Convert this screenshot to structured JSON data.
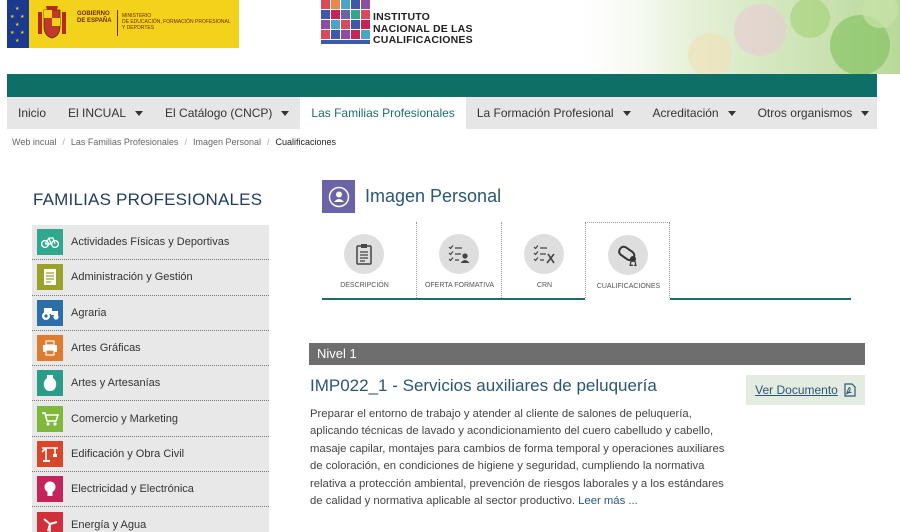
{
  "header": {
    "gov_name": [
      "GOBIERNO",
      "DE ESPAÑA"
    ],
    "ministry_name": [
      "MINISTERIO",
      "DE EDUCACIÓN, FORMACIÓN PROFESIONAL",
      "Y DEPORTES"
    ],
    "institute_name": [
      "INSTITUTO",
      "NACIONAL DE LAS",
      "CUALIFICACIONES"
    ]
  },
  "nav": {
    "items": [
      {
        "label": "Inicio",
        "dropdown": false,
        "active": false
      },
      {
        "label": "El INCUAL",
        "dropdown": true,
        "active": false
      },
      {
        "label": "El Catálogo (CNCP)",
        "dropdown": true,
        "active": false
      },
      {
        "label": "Las Familias Profesionales",
        "dropdown": false,
        "active": true
      },
      {
        "label": "La Formación Profesional",
        "dropdown": true,
        "active": false
      },
      {
        "label": "Acreditación",
        "dropdown": true,
        "active": false
      },
      {
        "label": "Otros organismos",
        "dropdown": true,
        "active": false
      }
    ]
  },
  "breadcrumb": {
    "items": [
      "Web incual",
      "Las Familias Profesionales",
      "Imagen Personal"
    ],
    "current": "Cualificaciones"
  },
  "sidebar": {
    "title": "FAMILIAS PROFESIONALES",
    "items": [
      {
        "label": "Actividades Físicas y Deportivas",
        "color": "#2fa88e",
        "icon": "bicycle-icon"
      },
      {
        "label": "Administración y Gestión",
        "color": "#9aa22c",
        "icon": "document-icon"
      },
      {
        "label": "Agraria",
        "color": "#2b6ea8",
        "icon": "tractor-icon"
      },
      {
        "label": "Artes Gráficas",
        "color": "#e07a2e",
        "icon": "printer-icon"
      },
      {
        "label": "Artes y Artesanías",
        "color": "#2a9d8a",
        "icon": "vase-icon"
      },
      {
        "label": "Comercio y Marketing",
        "color": "#7fb83a",
        "icon": "cart-icon"
      },
      {
        "label": "Edificación y Obra Civil",
        "color": "#d9472b",
        "icon": "crane-icon"
      },
      {
        "label": "Electricidad y Electrónica",
        "color": "#c4245a",
        "icon": "bulb-icon"
      },
      {
        "label": "Energía y Agua",
        "color": "#d12f3a",
        "icon": "windmill-icon"
      }
    ]
  },
  "main": {
    "family_title": "Imagen Personal",
    "family_color": "#6a63a8",
    "tabs": [
      {
        "label": "DESCRIPCIÓN",
        "icon": "clipboard-icon",
        "active": false
      },
      {
        "label": "OFERTA FORMATIVA",
        "icon": "checklist-person-icon",
        "active": false
      },
      {
        "label": "CRN",
        "icon": "checklist-tools-icon",
        "active": false
      },
      {
        "label": "CUALIFICACIONES",
        "icon": "diploma-icon",
        "active": true
      }
    ],
    "level_label": "Nivel 1",
    "qualification": {
      "title": "IMP022_1 - Servicios auxiliares de peluquería",
      "doc_button": "Ver Documento",
      "description": "Preparar el entorno de trabajo y atender al cliente de salones de peluquería, aplicando técnicas de lavado y acondicionamiento del cuero cabelludo y cabello, masaje capilar, montajes para cambios de forma temporal y operaciones auxiliares de coloración, en condiciones de higiene y seguridad, cumpliendo la normativa relativa a protección ambiental, prevención de riesgos laborales y a los estándares de calidad y normativa aplicable al sector productivo.",
      "read_more": "Leer más ..."
    }
  },
  "colors": {
    "teal": "#0e6f67",
    "nav_bg": "#e6e6e6",
    "level_bar": "#6e6e6e",
    "title_blue": "#2a5677"
  }
}
